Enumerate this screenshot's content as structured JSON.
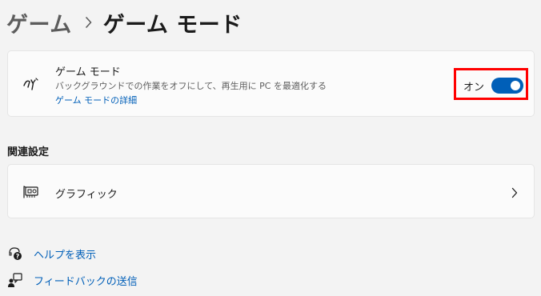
{
  "breadcrumb": {
    "parent": "ゲーム",
    "current": "ゲーム モード",
    "separator_icon": "chevron-right-icon"
  },
  "game_mode_card": {
    "icon": "game-mode-icon",
    "title": "ゲーム モード",
    "description": "バックグラウンドでの作業をオフにして、再生用に PC を最適化する",
    "link_text": "ゲーム モードの詳細",
    "toggle": {
      "label": "オン",
      "state": "on",
      "highlight_color": "#ff0000"
    }
  },
  "related_settings": {
    "heading": "関連設定",
    "items": [
      {
        "icon": "graphics-card-icon",
        "label": "グラフィック",
        "trailing_icon": "chevron-right-icon"
      }
    ]
  },
  "help_links": [
    {
      "icon": "help-icon",
      "label": "ヘルプを表示"
    },
    {
      "icon": "feedback-icon",
      "label": "フィードバックの送信"
    }
  ],
  "colors": {
    "accent": "#005fb8",
    "background": "#f3f3f3",
    "card": "#fbfbfb"
  }
}
